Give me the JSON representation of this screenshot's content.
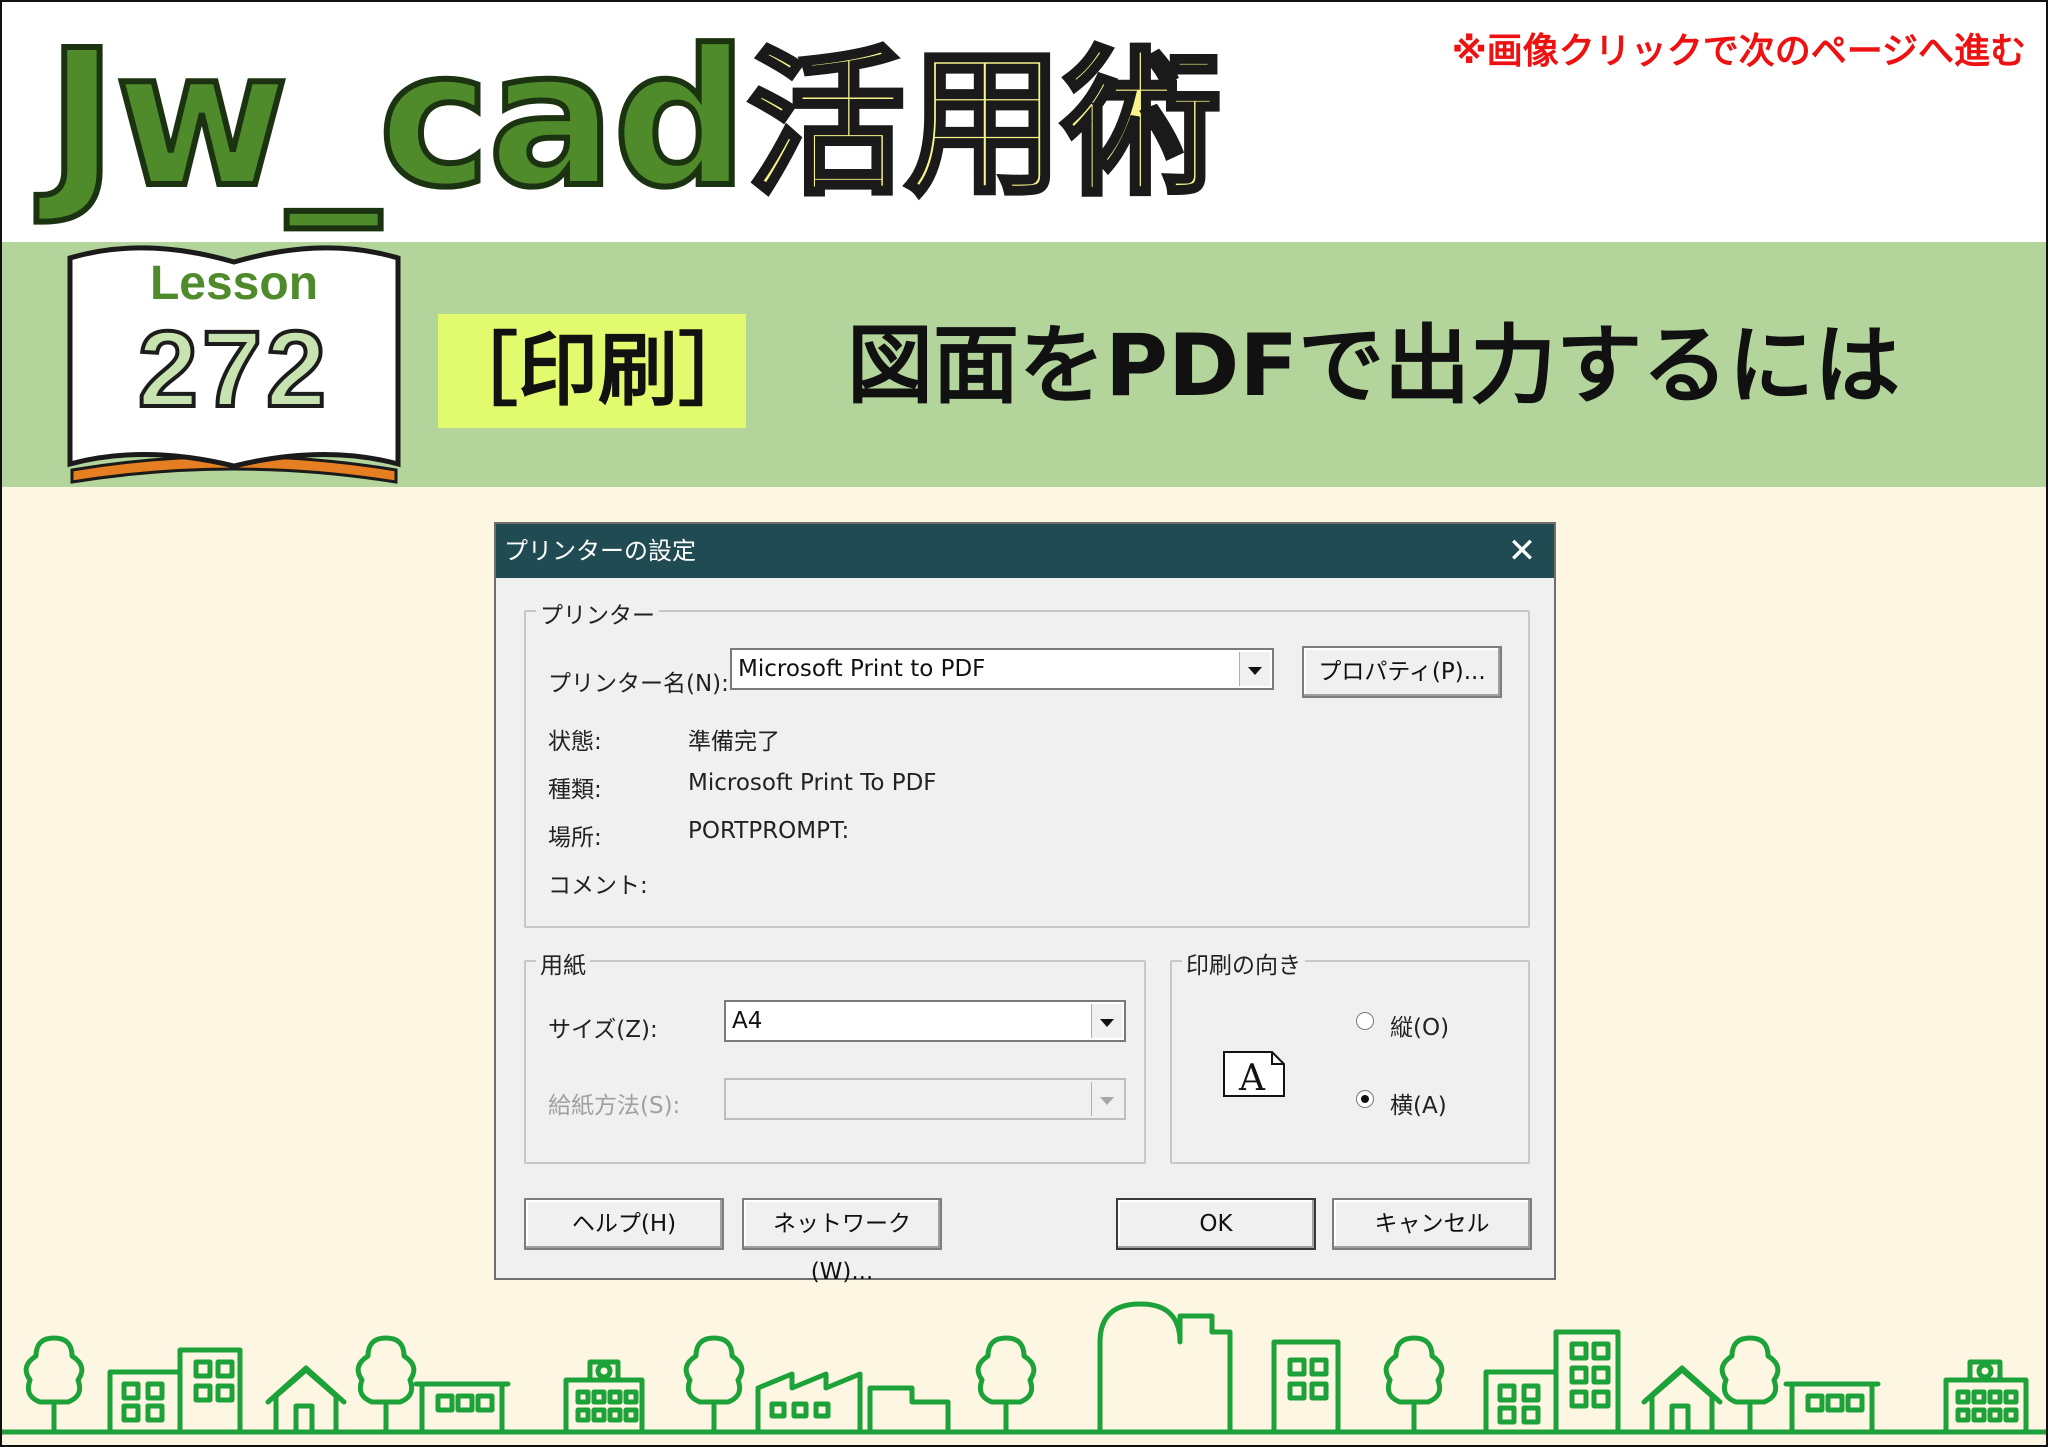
{
  "header": {
    "logo_en": "Jw_cad",
    "logo_ja": "活用術",
    "notice": "※画像クリックで次のページへ進む"
  },
  "lesson": {
    "label": "Lesson",
    "number": "272",
    "category": "［印刷］",
    "title": "図面をPDFで出力するには"
  },
  "colors": {
    "brand_green": "#4f8a2b",
    "band_green": "#b3d59c",
    "category_yellow": "#e2fb6e",
    "logo_yellow": "#f6f48a",
    "notice_red": "#ee1111",
    "titlebar": "#214b52",
    "background": "#fdf6e3"
  },
  "dialog": {
    "title": "プリンターの設定",
    "close_icon": "close-icon",
    "printer_group": {
      "label": "プリンター",
      "name_label": "プリンター名(N):",
      "name_value": "Microsoft Print to PDF",
      "properties_button": "プロパティ(P)...",
      "status_label": "状態:",
      "status_value": "準備完了",
      "type_label": "種類:",
      "type_value": "Microsoft Print To PDF",
      "location_label": "場所:",
      "location_value": "PORTPROMPT:",
      "comment_label": "コメント:",
      "comment_value": ""
    },
    "paper_group": {
      "label": "用紙",
      "size_label": "サイズ(Z):",
      "size_value": "A4",
      "source_label": "給紙方法(S):",
      "source_value": ""
    },
    "orientation_group": {
      "label": "印刷の向き",
      "icon_letter": "A",
      "portrait_label": "縦(O)",
      "landscape_label": "横(A)",
      "selected": "landscape"
    },
    "buttons": {
      "help": "ヘルプ(H)",
      "network": "ネットワーク(W)...",
      "ok": "OK",
      "cancel": "キャンセル"
    }
  }
}
